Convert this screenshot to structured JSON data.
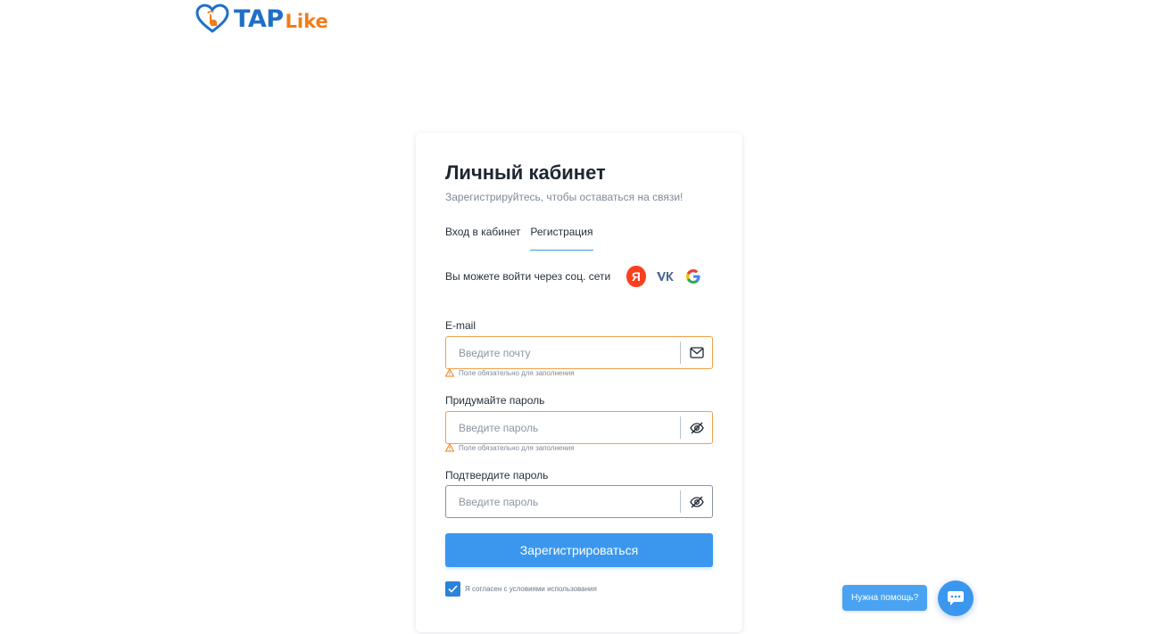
{
  "logo": {
    "part1": "TAP",
    "part2": "Like",
    "icon": "heart-touch-icon"
  },
  "card": {
    "title": "Личный кабинет",
    "subtitle": "Зарегистрируйтесь, чтобы оставаться на связи!",
    "tabs": [
      {
        "label": "Вход в кабинет",
        "active": false
      },
      {
        "label": "Регистрация",
        "active": true
      }
    ],
    "social": {
      "label": "Вы можете войти через соц. сети",
      "providers": [
        {
          "name": "yandex",
          "glyph": "Я"
        },
        {
          "name": "vk",
          "glyph": "VK"
        },
        {
          "name": "google",
          "glyph": "G"
        }
      ]
    },
    "fields": {
      "email": {
        "label": "E-mail",
        "placeholder": "Введите почту",
        "value": "",
        "icon": "envelope-icon",
        "error": "Поле обязательно для заполнения"
      },
      "password": {
        "label": "Придумайте пароль",
        "placeholder": "Введите пароль",
        "value": "",
        "icon": "eye-hidden-icon",
        "error": "Поле обязательно для заполнения"
      },
      "confirm": {
        "label": "Подтвердите пароль",
        "placeholder": "Введите пароль",
        "value": "",
        "icon": "eye-hidden-icon"
      }
    },
    "submit_label": "Зарегистрироваться",
    "agree": {
      "checked": true,
      "label": "Я согласен с условиями использования"
    }
  },
  "help": {
    "label": "Нужна помощь?",
    "icon": "chat-bubble-icon"
  },
  "colors": {
    "brand_blue": "#1f6fc9",
    "brand_orange": "#f07d1a",
    "accent": "#3b97ee",
    "error_border": "#f0a04b",
    "yandex_red": "#fc3f1d"
  }
}
